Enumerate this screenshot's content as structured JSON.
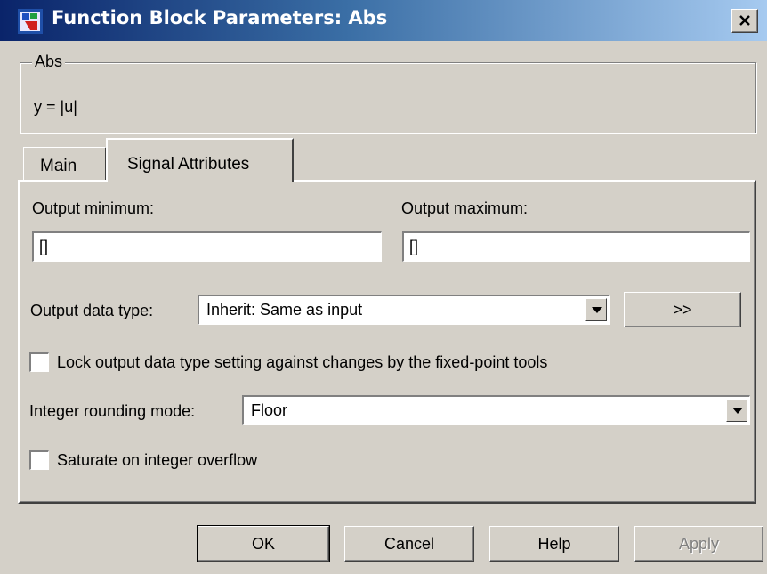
{
  "window": {
    "title": "Function Block Parameters: Abs",
    "close_icon": "close-icon"
  },
  "group": {
    "legend": "Abs",
    "description": "y = |u|"
  },
  "tabs": [
    {
      "label": "Main",
      "active": false
    },
    {
      "label": "Signal Attributes",
      "active": true
    }
  ],
  "signal": {
    "output_min_label": "Output minimum:",
    "output_min_value": "[]",
    "output_max_label": "Output maximum:",
    "output_max_value": "[]",
    "data_type_label": "Output data type:",
    "data_type_value": "Inherit: Same as input",
    "assistant_button": ">>",
    "lock_label": "Lock output data type setting against changes by the fixed-point tools",
    "lock_checked": false,
    "rounding_label": "Integer rounding mode:",
    "rounding_value": "Floor",
    "saturate_label": "Saturate on integer overflow",
    "saturate_checked": false
  },
  "buttons": {
    "ok": "OK",
    "cancel": "Cancel",
    "help": "Help",
    "apply": "Apply"
  }
}
